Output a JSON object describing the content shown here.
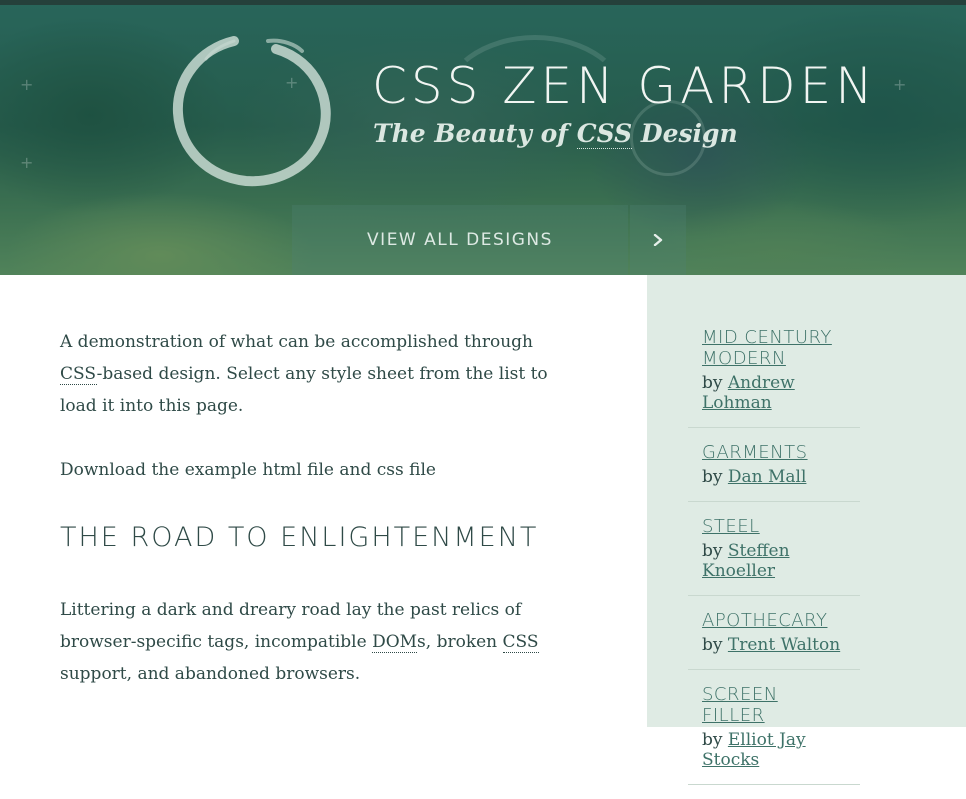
{
  "header": {
    "title": "CSS ZEN GARDEN",
    "tagline_pre": "The Beauty of ",
    "tagline_abbr": "CSS",
    "tagline_post": " Design",
    "view_all_label": "VIEW ALL DESIGNS",
    "view_all_icon": "chevron-right-icon"
  },
  "intro": {
    "p1_pre": "A demonstration of what can be accomplished through ",
    "p1_abbr": "CSS",
    "p1_post": "-based design. Select any style sheet from the list to load it into this page.",
    "p2": "Download the example html file and css file"
  },
  "explanation": {
    "heading": "THE ROAD TO ENLIGHTENMENT",
    "p_pre": "Littering a dark and dreary road lay the past relics of browser-specific tags, incompatible ",
    "p_abbr1": "DOM",
    "p_mid": "s, broken ",
    "p_abbr2": "CSS",
    "p_post": " support, and abandoned browsers."
  },
  "sidebar": {
    "designs": [
      {
        "name": "MID CENTURY MODERN",
        "by": "by ",
        "designer": "Andrew Lohman"
      },
      {
        "name": "GARMENTS",
        "by": "by ",
        "designer": "Dan Mall"
      },
      {
        "name": "STEEL",
        "by": "by ",
        "designer": "Steffen Knoeller"
      },
      {
        "name": "APOTHECARY",
        "by": "by ",
        "designer": "Trent Walton"
      },
      {
        "name": "SCREEN FILLER",
        "by": "by ",
        "designer": "Elliot Jay Stocks"
      }
    ]
  },
  "colors": {
    "accent_link": "#3e7268",
    "sidebar_bg": "#dfebe4",
    "body_text": "#2f4a47"
  }
}
